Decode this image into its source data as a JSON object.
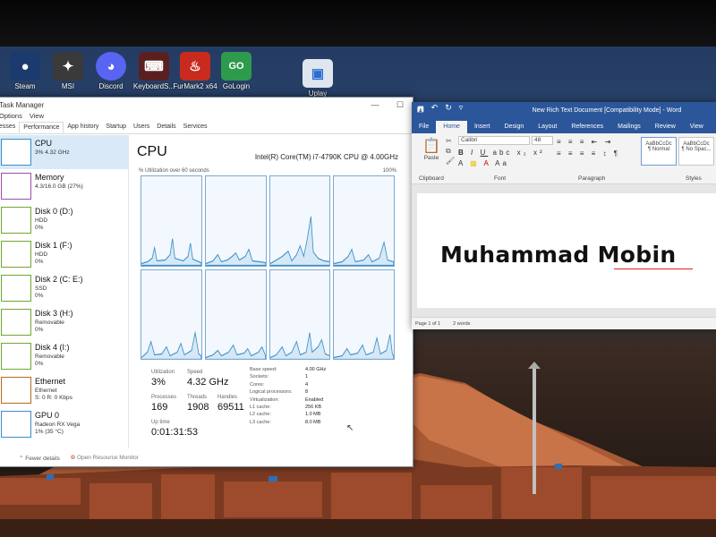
{
  "desktop": {
    "icons": [
      {
        "label": "Steam",
        "glyph": "●",
        "color": "#1b3b6f"
      },
      {
        "label": "MSI",
        "glyph": "✦",
        "color": "#3a3a3a"
      },
      {
        "label": "Discord",
        "glyph": "◕",
        "color": "#5865f2"
      },
      {
        "label": "KeyboardS...",
        "glyph": "⌨",
        "color": "#5a2020"
      },
      {
        "label": "FurMark2 x64",
        "glyph": "♨",
        "color": "#c92a1e"
      },
      {
        "label": "GoLogin",
        "glyph": "GO",
        "color": "#2e9a4c"
      },
      {
        "label": "Uplay",
        "glyph": "▣",
        "color": "#dfe6ee"
      }
    ]
  },
  "taskmanager": {
    "title": "Task Manager",
    "menu": [
      "Options",
      "View"
    ],
    "tabs": [
      "esses",
      "Performance",
      "App history",
      "Startup",
      "Users",
      "Details",
      "Services"
    ],
    "active_tab": "Performance",
    "resources": [
      {
        "name": "CPU",
        "sub1": "3% 4.32 GHz",
        "sub2": ""
      },
      {
        "name": "Memory",
        "sub1": "4.3/16.0 GB (27%)",
        "sub2": ""
      },
      {
        "name": "Disk 0 (D:)",
        "sub1": "HDD",
        "sub2": "0%"
      },
      {
        "name": "Disk 1 (F:)",
        "sub1": "HDD",
        "sub2": "0%"
      },
      {
        "name": "Disk 2 (C: E:)",
        "sub1": "SSD",
        "sub2": "0%"
      },
      {
        "name": "Disk 3 (H:)",
        "sub1": "Removable",
        "sub2": "0%"
      },
      {
        "name": "Disk 4 (I:)",
        "sub1": "Removable",
        "sub2": "0%"
      },
      {
        "name": "Ethernet",
        "sub1": "Ethernet",
        "sub2": "S: 0 R: 0 Kbps"
      },
      {
        "name": "GPU 0",
        "sub1": "Radeon RX Vega",
        "sub2": "1% (35 °C)"
      }
    ],
    "cpu": {
      "title": "CPU",
      "model": "Intel(R) Core(TM) i7-4790K CPU @ 4.00GHz",
      "util_label": "% Utilization over 60 seconds",
      "util_max": "100%",
      "utilization_label": "Utilization",
      "utilization": "3%",
      "speed_label": "Speed",
      "speed": "4.32 GHz",
      "processes_label": "Processes",
      "processes": "169",
      "threads_label": "Threads",
      "threads": "1908",
      "handles_label": "Handles",
      "handles": "69511",
      "uptime_label": "Up time",
      "uptime": "0:01:31:53",
      "details": [
        {
          "k": "Base speed:",
          "v": "4.00 GHz"
        },
        {
          "k": "Sockets:",
          "v": "1"
        },
        {
          "k": "Cores:",
          "v": "4"
        },
        {
          "k": "Logical processors:",
          "v": "8"
        },
        {
          "k": "Virtualization:",
          "v": "Enabled"
        },
        {
          "k": "L1 cache:",
          "v": "256 KB"
        },
        {
          "k": "L2 cache:",
          "v": "1.0 MB"
        },
        {
          "k": "L3 cache:",
          "v": "8.0 MB"
        }
      ]
    },
    "footer": {
      "fewer": "Fewer details",
      "monitor": "Open Resource Monitor"
    }
  },
  "word": {
    "title": "New Rich Text Document [Compatibility Mode] - Word",
    "tabs": [
      "File",
      "Home",
      "Insert",
      "Design",
      "Layout",
      "References",
      "Mailings",
      "Review",
      "View"
    ],
    "active_tab": "Home",
    "font": "Calibri",
    "size": "48",
    "paste": "Paste",
    "groups": {
      "clipboard": "Clipboard",
      "font": "Font",
      "paragraph": "Paragraph",
      "styles": "Styles"
    },
    "styles": [
      {
        "sample": "AaBbCcDc",
        "name": "¶ Normal"
      },
      {
        "sample": "AaBbCcDc",
        "name": "¶ No Spac..."
      }
    ],
    "body_text": "Muhammad Mobin",
    "status": {
      "page": "Page 1 of 1",
      "words": "2 words"
    }
  }
}
